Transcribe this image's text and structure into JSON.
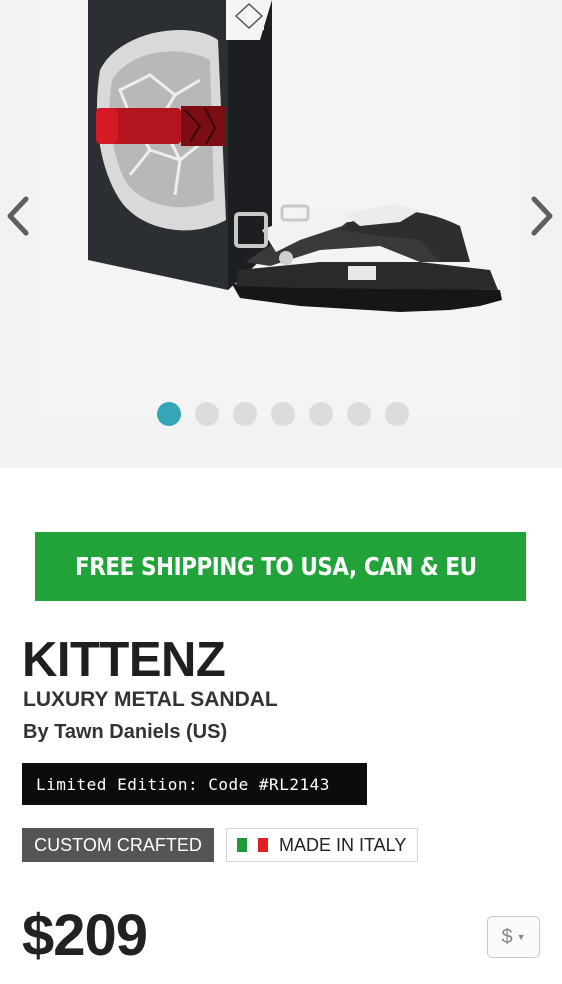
{
  "gallery": {
    "slide_count": 7,
    "active_slide": 1,
    "prev_icon": "chevron-left-icon",
    "next_icon": "chevron-right-icon",
    "active_dot_color": "#35a6b8"
  },
  "shipping": {
    "text": "FREE SHIPPING TO USA, CAN & EU",
    "icon": "airplane-icon",
    "color": "#22a33a"
  },
  "product": {
    "name": "KITTENZ",
    "subtitle": "LUXURY METAL SANDAL",
    "designer_prefix": "By ",
    "designer_name": "Tawn Daniels (US)",
    "edition": "Limited Edition: Code #RL2143",
    "crafted": "CUSTOM CRAFTED",
    "made_in": "MADE IN ITALY",
    "price": "$209"
  },
  "currency": {
    "selected": "$"
  }
}
